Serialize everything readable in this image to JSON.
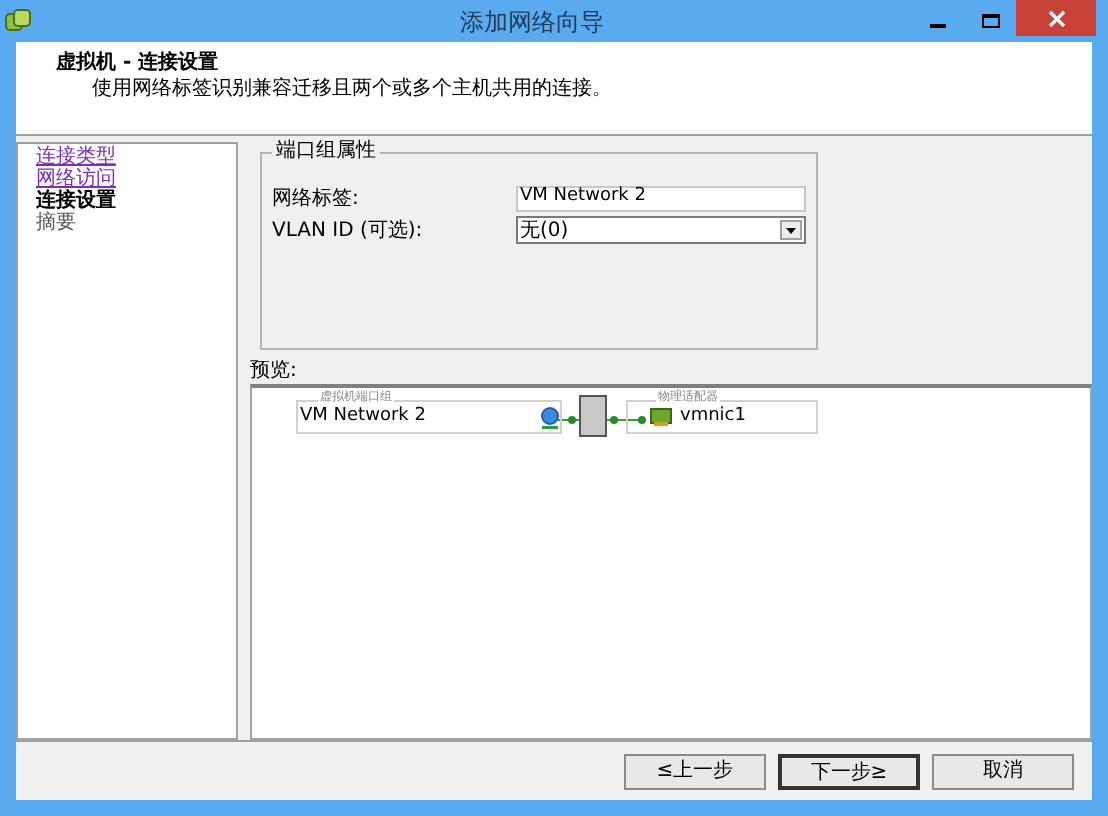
{
  "window": {
    "title": "添加网络向导"
  },
  "header": {
    "title": "虚拟机 - 连接设置",
    "description": "使用网络标签识别兼容迁移且两个或多个主机共用的连接。"
  },
  "steps": [
    {
      "label": "连接类型",
      "kind": "link"
    },
    {
      "label": "网络访问",
      "kind": "link"
    },
    {
      "label": "连接设置",
      "kind": "current"
    },
    {
      "label": "摘要",
      "kind": "pending"
    }
  ],
  "port_group": {
    "title": "端口组属性",
    "fields": [
      {
        "label": "网络标签:",
        "value": "VM Network 2",
        "kind": "text"
      },
      {
        "label": "VLAN ID (可选):",
        "value": "无(0)",
        "kind": "dropdown"
      }
    ]
  },
  "preview": {
    "label": "预览:",
    "port_group_title": "虚拟机端口组",
    "network": "VM Network 2",
    "adapter_title": "物理适配器",
    "adapter": "vmnic1"
  },
  "buttons": [
    {
      "label": "≤上一步",
      "default": false
    },
    {
      "label": "下一步≥",
      "default": true
    },
    {
      "label": "取消",
      "default": false
    }
  ]
}
